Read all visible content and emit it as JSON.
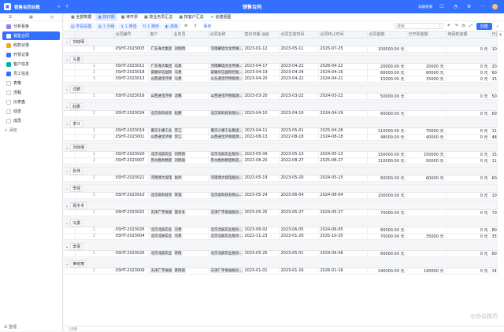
{
  "app": {
    "name": "销售合同台账",
    "title": "销售合同"
  },
  "topbar": {
    "share_label": "高级权限",
    "more_label": "···"
  },
  "sidebar": {
    "tabs": [
      "☰",
      "▦",
      "◷"
    ],
    "items": [
      {
        "label": "分析看板",
        "color": "#8a7ff5"
      },
      {
        "label": "销售合同",
        "color": "#ffffff",
        "active": true
      },
      {
        "label": "收款记录",
        "color": "#f5a623"
      },
      {
        "label": "开票记录",
        "color": "#3370ff"
      },
      {
        "label": "客户信息",
        "color": "#00b3a1"
      },
      {
        "label": "员工信息",
        "color": "#3370ff"
      },
      {
        "label": "表格",
        "color": "#c0c4cc"
      },
      {
        "label": "流程",
        "color": "#c0c4cc"
      },
      {
        "label": "仪表盘",
        "color": "#c0c4cc"
      },
      {
        "label": "动态",
        "color": "#c0c4cc"
      },
      {
        "label": "成员",
        "color": "#c0c4cc"
      }
    ],
    "add_label": "添加",
    "footer_label": "整理"
  },
  "views": [
    "全部数据",
    "按日期",
    "待开票",
    "按业务员汇总",
    "按客户汇总",
    "创建视图"
  ],
  "toolbar": {
    "field_config": "字段设置",
    "group": "1 分组",
    "filter": "1 筛选",
    "sort": "1 排序",
    "highlight": "高级",
    "save": "保存",
    "search_placeholder": "搜索",
    "create": "创建"
  },
  "columns": [
    "合同编号",
    "客户",
    "业务员",
    "合同名称",
    "签约日期",
    "合同生效时间",
    "合同终止时间",
    "合同金额",
    "已开票金额",
    "待回款金额",
    "已回款金额"
  ],
  "sort_badge": "升序",
  "groups": [
    {
      "name": "刘晓明",
      "rows": [
        {
          "n": "1",
          "id": "XSHT-2023003",
          "client": "广东海大集团...",
          "rep": "刘晓明",
          "name": "河南幕墙文化传媒...",
          "sign": "2023-01-12",
          "start": "2023-05-11",
          "end": "2025-07-25",
          "amount": "100000.00 元",
          "invoiced": "",
          "pending": "0 元",
          "received": "100000 元"
        }
      ]
    },
    {
      "name": "马勇",
      "rows": [
        {
          "n": "1",
          "id": "XSHT-2023012",
          "client": "广东海大集团...",
          "rep": "马勇",
          "name": "河南幕墙文化传媒...",
          "sign": "2023-04-17",
          "start": "2023-04-22",
          "end": "2026-04-22",
          "amount": "20000.00 元",
          "invoiced": "20000 元",
          "pending": "0 元",
          "received": "20000 元"
        },
        {
          "n": "2",
          "id": "XSHT-2023018",
          "client": "安徽华信国际控股...",
          "rep": "马勇",
          "name": "安徽华信国际控股...",
          "sign": "2023-04-19",
          "start": "2023-04-24",
          "end": "2024-04-16",
          "amount": "60000.00 元",
          "invoiced": "60000 元",
          "pending": "0 元",
          "received": "60000 元"
        },
        {
          "n": "3",
          "id": "XSHT-2023013",
          "client": "山西通宝环保能...",
          "rep": "马勇",
          "name": "山东通宝环保能源...",
          "sign": "2023-04-20",
          "start": "2023-04-22",
          "end": "2024-04-21",
          "amount": "15000.00 元",
          "invoiced": "15000 元",
          "pending": "0 元",
          "received": "15000 元"
        }
      ]
    },
    {
      "name": "沈鹏",
      "rows": [
        {
          "n": "1",
          "id": "XSHT-2023016",
          "client": "山西通宝环保能...",
          "rep": "沈鹏",
          "name": "山西通宝环保能源...",
          "sign": "2023-03-20",
          "start": "2023-03-22",
          "end": "2024-03-22",
          "amount": "50000.00 元",
          "invoiced": "",
          "pending": "0 元",
          "received": "50000 元"
        }
      ]
    },
    {
      "name": "赵鹏",
      "rows": [
        {
          "n": "1",
          "id": "XSHT-2023024",
          "client": "北京高科技有限...",
          "rep": "赵鹏",
          "name": "北京高科技有限公...",
          "sign": "2023-04-10",
          "start": "2023-04-19",
          "end": "2024-04-19",
          "amount": "60000.00 元",
          "invoiced": "",
          "pending": "0 元",
          "received": "60000 元"
        }
      ]
    },
    {
      "name": "李江",
      "rows": [
        {
          "n": "1",
          "id": "XSHT-2023019",
          "client": "重庆小康工业集...",
          "rep": "李江",
          "name": "重庆小康工业集团...",
          "sign": "2023-04-11",
          "start": "2023-05-01",
          "end": "2025-04-28",
          "amount": "110000.00 元",
          "invoiced": "70000 元",
          "pending": "0 元",
          "received": "110000 元"
        },
        {
          "n": "2",
          "id": "XSHT-2023001",
          "client": "山西通宝环保能...",
          "rep": "李江",
          "name": "山西通宝环保能源...",
          "sign": "2022-08-13",
          "start": "2022-08-18",
          "end": "2024-08-18",
          "amount": "48000.00 元",
          "invoiced": "40000 元",
          "pending": "0 元",
          "received": "48000 元"
        }
      ]
    },
    {
      "name": "刘晓丽",
      "rows": [
        {
          "n": "1",
          "id": "XSHT-2023020",
          "client": "北京北辰实业集...",
          "rep": "刘晓丽",
          "name": "北京北辰实业股份...",
          "sign": "2023-05-09",
          "start": "2023-05-13",
          "end": "2024-05-13",
          "amount": "150000.00 元",
          "invoiced": "150000 元",
          "pending": "0 元",
          "received": "150000 元"
        },
        {
          "n": "2",
          "id": "XSHT-2023007",
          "client": "苏州胜利精密制...",
          "rep": "刘晓丽",
          "name": "苏州胜利精密制造...",
          "sign": "2022-08-20",
          "start": "2022-08-27",
          "end": "2025-08-27",
          "amount": "110000.00 元",
          "invoiced": "50000 元",
          "pending": "0 元",
          "received": "110000 元"
        }
      ]
    },
    {
      "name": "张伟",
      "rows": [
        {
          "n": "1",
          "id": "XSHT-2023021",
          "client": "河南博大煤电...",
          "rep": "张伟",
          "name": "河南博大煤电股份...",
          "sign": "2023-05-19",
          "start": "2023-05-20",
          "end": "2024-05-15",
          "amount": "60000.00 元",
          "invoiced": "60000 元",
          "pending": "0 元",
          "received": "60000 元"
        }
      ]
    },
    {
      "name": "李强",
      "rows": [
        {
          "n": "1",
          "id": "XSHT-2023010",
          "client": "北京高科技有限...",
          "rep": "李强",
          "name": "北京高科技有限公...",
          "sign": "2023-05-24",
          "start": "2023-06-04",
          "end": "2024-06-04",
          "amount": "100000.00 元",
          "invoiced": "",
          "pending": "0 元",
          "received": "100000 元"
        }
      ]
    },
    {
      "name": "聂冬冬",
      "rows": [
        {
          "n": "1",
          "id": "XSHT-2023022",
          "client": "天津广宇发展股...",
          "rep": "聂冬冬",
          "name": "天津广宇发展股份...",
          "sign": "2023-05-25",
          "start": "2023-05-27",
          "end": "2024-05-27",
          "amount": "70000.00 元",
          "invoiced": "",
          "pending": "0 元",
          "received": "70000 元"
        }
      ]
    },
    {
      "name": "冯勇",
      "rows": [
        {
          "n": "1",
          "id": "XSHT-2023026",
          "client": "北京北辰实业集...",
          "rep": "冯勇",
          "name": "北京北辰实业股份...",
          "sign": "2023-06-02",
          "start": "2023-06-05",
          "end": "2024-06-05",
          "amount": "80000.00 元",
          "invoiced": "",
          "pending": "0 元",
          "received": "80000 元"
        },
        {
          "n": "2",
          "id": "XSHT-2023004",
          "client": "北京北辰实业集...",
          "rep": "冯勇",
          "name": "北京北辰实业股份...",
          "sign": "2022-11-23",
          "start": "2023-01-20",
          "end": "2025-10-20",
          "amount": "70000.00 元",
          "invoiced": "35000 元",
          "pending": "0 元",
          "received": "35000 元"
        }
      ]
    },
    {
      "name": "李倩",
      "rows": [
        {
          "n": "1",
          "id": "XSHT-2023026",
          "client": "北京北辰实业集...",
          "rep": "李倩",
          "name": "北京北辰实业股份...",
          "sign": "2023-05-25",
          "start": "2023-05-01",
          "end": "2024-06-08",
          "amount": "60000.00 元",
          "invoiced": "",
          "pending": "0 元",
          "received": "60000 元"
        }
      ]
    },
    {
      "name": "黄晓丽",
      "rows": [
        {
          "n": "1",
          "id": "XSHT-2023009",
          "client": "天津广宇发展股...",
          "rep": "黄晓丽",
          "name": "天津广宇发展股份...",
          "sign": "2023-01-01",
          "start": "2023-01-16",
          "end": "2026-01-16",
          "amount": "140000.00 元",
          "invoiced": "140000 元",
          "pending": "0 元",
          "received": "140000 元"
        }
      ]
    }
  ],
  "footer": {
    "count": "18条"
  },
  "watermark": "@办公技巧"
}
